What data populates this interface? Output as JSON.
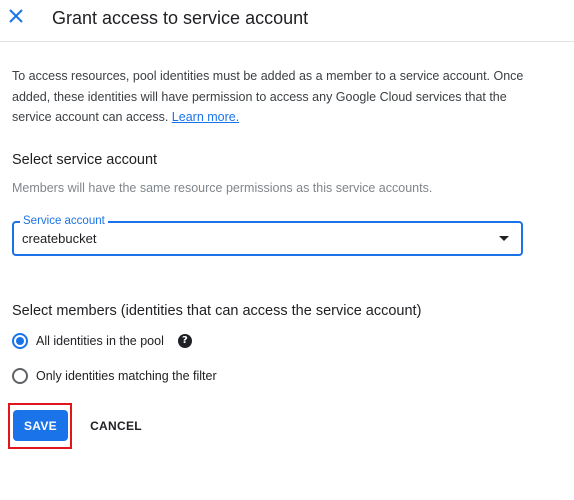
{
  "header": {
    "title": "Grant access to service account",
    "close_icon": "close-icon"
  },
  "intro": {
    "text": "To access resources, pool identities must be added as a member to a service account. Once added, these identities will have permission to access any Google Cloud services that the service account can access. ",
    "link_label": "Learn more."
  },
  "service_account_section": {
    "title": "Select service account",
    "helper": "Members will have the same resource permissions as this service accounts.",
    "field_label": "Service account",
    "selected_value": "createbucket"
  },
  "members_section": {
    "title": "Select members (identities that can access the service account)",
    "options": [
      {
        "label": "All identities in the pool",
        "checked": true
      },
      {
        "label": "Only identities matching the filter",
        "checked": false
      }
    ],
    "help_icon_glyph": "?"
  },
  "actions": {
    "save_label": "SAVE",
    "cancel_label": "CANCEL"
  },
  "colors": {
    "accent": "#1a73e8",
    "highlight": "#e0161c"
  }
}
